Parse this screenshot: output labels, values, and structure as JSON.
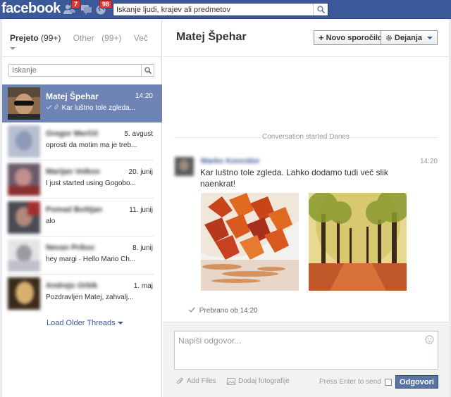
{
  "topbar": {
    "logo": "facebook",
    "friend_requests_count": "7",
    "messages_count": "",
    "notifications_count": "98",
    "search_placeholder": "Iskanje ljudi, krajev ali predmetov"
  },
  "folders": {
    "inbox_label": "Prejeto",
    "inbox_count": "(99+)",
    "other_label": "Other",
    "other_count": "(99+)",
    "more_label": "Več"
  },
  "thread_search_placeholder": "Iskanje",
  "threads": [
    {
      "name": "Matej Špehar",
      "time": "14:20",
      "snippet": "Kar luštno tole zgleda...",
      "selected": true
    },
    {
      "name": "Gregor Merčič",
      "time": "5. avgust",
      "snippet": "oprosti da motim ma je treb..."
    },
    {
      "name": "Marijan Volkov",
      "time": "20. junij",
      "snippet": "I just started using Gogobo..."
    },
    {
      "name": "Pomad Boštjan",
      "time": "11. junij",
      "snippet": "alo"
    },
    {
      "name": "Nevan Prikoc",
      "time": "8. junij",
      "snippet": "hey margi · Hello Mario Ch..."
    },
    {
      "name": "Andrejo Orbik",
      "time": "1. maj",
      "snippet": "Pozdravljen Matej, zahvalj..."
    }
  ],
  "load_older": "Load Older Threads",
  "conversation": {
    "title": "Matej Špehar",
    "new_message_button": "Novo sporočilo!",
    "actions_button": "Dejanja",
    "started_label": "Conversation started Danes",
    "message": {
      "sender": "Marko Koncidor",
      "time": "14:20",
      "text": "Kar luštno tole zgleda. Lahko dodamo tudi več slik naenkrat!"
    },
    "seen_label": "Prebrano ob 14:20"
  },
  "composer": {
    "placeholder": "Napiši odgovor...",
    "add_files": "Add Files",
    "add_photos": "Dodaj fotografije",
    "enter_to_send": "Press Enter to send",
    "reply_button": "Odgovori"
  },
  "colors": {
    "brand": "#3b5998",
    "selected_thread": "#6d84b4",
    "badge": "#e0383b",
    "link": "#3b5998"
  }
}
